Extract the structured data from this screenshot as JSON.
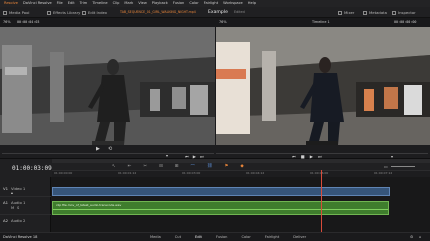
{
  "menubar": {
    "app_label": "Resolve",
    "items": [
      "DaVinci Resolve",
      "File",
      "Edit",
      "Trim",
      "Timeline",
      "Clip",
      "Mark",
      "View",
      "Playback",
      "Fusion",
      "Color",
      "Fairlight",
      "Workspace",
      "Help"
    ]
  },
  "toolbar": {
    "media_pool": "Media Pool",
    "effects_library": "Effects Library",
    "edit_index": "Edit Index",
    "source_clip_name": "TAB_SEQUENCE_01_GIRL_WALKING_NIGHT.mp4",
    "project_name": "Example",
    "project_status": "Edited",
    "mixer": "Mixer",
    "metadata": "Metadata",
    "inspector": "Inspector"
  },
  "viewer_header": {
    "zoom_left": "76%",
    "timecode_left": "00:00:04:03",
    "zoom_right": "76%",
    "timeline_name": "Timeline 1",
    "timecode_right": "00:00:00:00"
  },
  "timeline": {
    "current_timecode": "01:00:03:09",
    "ruler_marks": [
      "01:00:00:00",
      "01:00:01:12",
      "01:00:03:00",
      "01:00:04:12",
      "01:00:06:00",
      "01:00:07:12"
    ],
    "tracks": [
      {
        "id": "V1",
        "name": "Video 1",
        "type": "video"
      },
      {
        "id": "A1",
        "name": "Audio 1",
        "type": "audio"
      },
      {
        "id": "A2",
        "name": "Audio 2",
        "type": "audio"
      }
    ],
    "audio_clip_label": "clip file.mov_of_latest_audio.transcode.wav"
  },
  "footer": {
    "app_name": "DaVinci Resolve 18",
    "pages": [
      "Media",
      "Cut",
      "Edit",
      "Fusion",
      "Color",
      "Fairlight",
      "Deliver"
    ],
    "active_page": "Edit"
  },
  "colors": {
    "accent_orange": "#e8853a",
    "video_clip": "#36557a",
    "audio_clip": "#3f7d2d",
    "playhead": "#d84b3a"
  }
}
